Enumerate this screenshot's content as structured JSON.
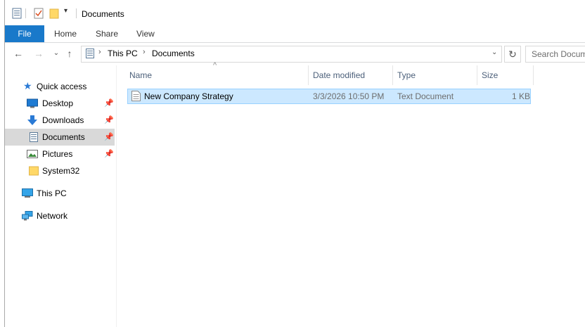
{
  "window": {
    "title": "Documents"
  },
  "ribbon": {
    "tabs": [
      "File",
      "Home",
      "Share",
      "View"
    ]
  },
  "address": {
    "path": [
      "This PC",
      "Documents"
    ],
    "search_placeholder": "Search Documents"
  },
  "nav": {
    "quick_access": "Quick access",
    "items": [
      {
        "label": "Desktop",
        "icon": "desktop-icon",
        "pinned": true
      },
      {
        "label": "Downloads",
        "icon": "downloads-icon",
        "pinned": true
      },
      {
        "label": "Documents",
        "icon": "documents-icon",
        "pinned": true,
        "selected": true
      },
      {
        "label": "Pictures",
        "icon": "pictures-icon",
        "pinned": true
      },
      {
        "label": "System32",
        "icon": "folder-icon",
        "pinned": false
      }
    ],
    "this_pc": "This PC",
    "network": "Network"
  },
  "columns": {
    "name": "Name",
    "date": "Date modified",
    "type": "Type",
    "size": "Size"
  },
  "files": [
    {
      "name": "New Company Strategy",
      "date": "3/3/2026 10:50 PM",
      "type": "Text Document",
      "size": "1 KB"
    }
  ],
  "colors": {
    "accent": "#1979ca",
    "selection": "#cce8ff",
    "selection_border": "#99d1ff"
  }
}
